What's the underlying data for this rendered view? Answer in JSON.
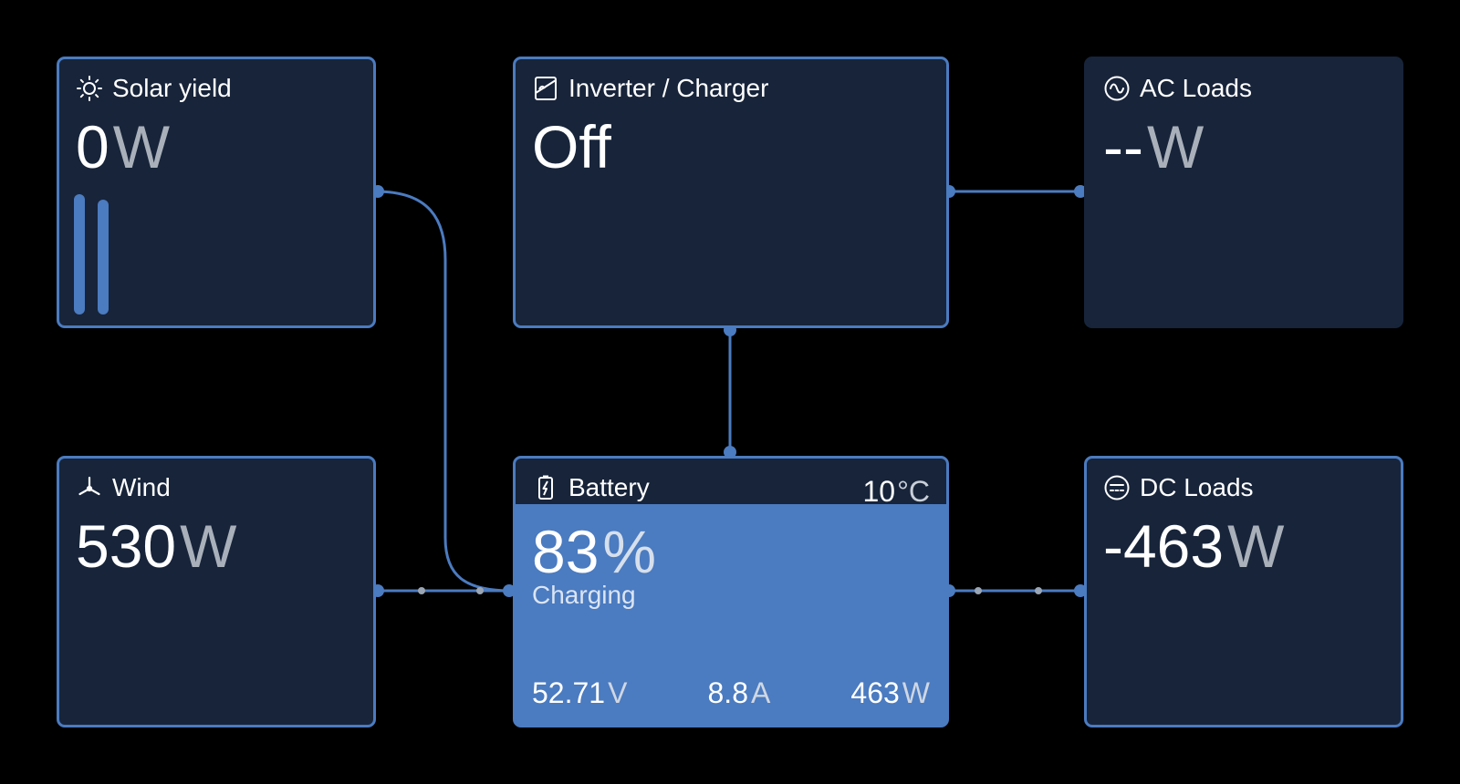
{
  "tiles": {
    "solar": {
      "title": "Solar yield",
      "value": "0",
      "unit": "W"
    },
    "inverter": {
      "title": "Inverter / Charger",
      "value": "Off"
    },
    "ac_loads": {
      "title": "AC Loads",
      "value": "--",
      "unit": "W"
    },
    "wind": {
      "title": "Wind",
      "value": "530",
      "unit": "W"
    },
    "battery": {
      "title": "Battery",
      "temperature": "10",
      "temperature_unit": "°C",
      "soc": "83",
      "soc_unit": "%",
      "status": "Charging",
      "voltage": "52.71",
      "voltage_unit": "V",
      "current": "8.8",
      "current_unit": "A",
      "power": "463",
      "power_unit": "W"
    },
    "dc_loads": {
      "title": "DC Loads",
      "value": "-463",
      "unit": "W"
    }
  },
  "icons": {
    "solar": "sun-icon",
    "inverter": "inverter-icon",
    "ac_loads": "ac-wave-icon",
    "wind": "wind-turbine-icon",
    "battery": "battery-charging-icon",
    "dc_loads": "dc-icon"
  },
  "colors": {
    "background": "#000000",
    "tile": "#17243a",
    "accent": "#4b7bc0",
    "unit_text": "#a9b0ba"
  }
}
